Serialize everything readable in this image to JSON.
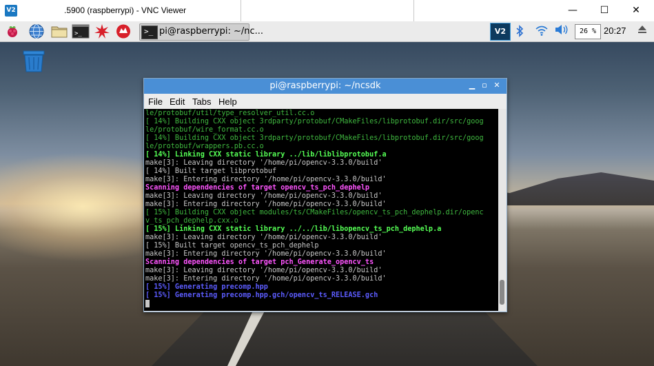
{
  "vnc_window": {
    "logo_text": "V2",
    "title": ".5900 (raspberrypi) - VNC Viewer",
    "controls": {
      "minimize": "—",
      "maximize": "☐",
      "close": "✕"
    }
  },
  "panel": {
    "launchers": [
      "raspberry-menu-icon",
      "web-browser-icon",
      "file-manager-icon",
      "terminal-icon",
      "mathematica-icon",
      "wolfram-icon"
    ],
    "taskbar": {
      "icon_text": ">_",
      "label": "pi@raspberrypi: ~/nc..."
    },
    "tray": {
      "vnc_label": "V2",
      "cpu": "26 %",
      "clock": "20:27"
    }
  },
  "desktop": {
    "trash": "trash-icon"
  },
  "terminal": {
    "title": "pi@raspberrypi: ~/ncsdk",
    "menu": [
      "File",
      "Edit",
      "Tabs",
      "Help"
    ],
    "lines": [
      {
        "text": "le/protobuf/util/type_resolver_util.cc.o",
        "style": "l-green"
      },
      {
        "text": "[ 14%] Building CXX object 3rdparty/protobuf/CMakeFiles/libprotobuf.dir/src/goog",
        "style": "l-green"
      },
      {
        "text": "le/protobuf/wire_format.cc.o",
        "style": "l-green"
      },
      {
        "text": "[ 14%] Building CXX object 3rdparty/protobuf/CMakeFiles/libprotobuf.dir/src/goog",
        "style": "l-green"
      },
      {
        "text": "le/protobuf/wrappers.pb.cc.o",
        "style": "l-green"
      },
      {
        "text": "[ 14%] Linking CXX static library ../lib/liblibprotobuf.a",
        "style": "l-bgreen"
      },
      {
        "text": "make[3]: Leaving directory '/home/pi/opencv-3.3.0/build'",
        "style": "l-grey"
      },
      {
        "text": "[ 14%] Built target libprotobuf",
        "style": "l-grey"
      },
      {
        "text": "make[3]: Entering directory '/home/pi/opencv-3.3.0/build'",
        "style": "l-grey"
      },
      {
        "text": "Scanning dependencies of target opencv_ts_pch_dephelp",
        "style": "l-magenta"
      },
      {
        "text": "make[3]: Leaving directory '/home/pi/opencv-3.3.0/build'",
        "style": "l-grey"
      },
      {
        "text": "make[3]: Entering directory '/home/pi/opencv-3.3.0/build'",
        "style": "l-grey"
      },
      {
        "text": "[ 15%] Building CXX object modules/ts/CMakeFiles/opencv_ts_pch_dephelp.dir/openc",
        "style": "l-green"
      },
      {
        "text": "v_ts_pch_dephelp.cxx.o",
        "style": "l-green"
      },
      {
        "text": "[ 15%] Linking CXX static library ../../lib/libopencv_ts_pch_dephelp.a",
        "style": "l-bgreen"
      },
      {
        "text": "make[3]: Leaving directory '/home/pi/opencv-3.3.0/build'",
        "style": "l-grey"
      },
      {
        "text": "[ 15%] Built target opencv_ts_pch_dephelp",
        "style": "l-grey"
      },
      {
        "text": "make[3]: Entering directory '/home/pi/opencv-3.3.0/build'",
        "style": "l-grey"
      },
      {
        "text": "Scanning dependencies of target pch_Generate_opencv_ts",
        "style": "l-magenta"
      },
      {
        "text": "make[3]: Leaving directory '/home/pi/opencv-3.3.0/build'",
        "style": "l-grey"
      },
      {
        "text": "make[3]: Entering directory '/home/pi/opencv-3.3.0/build'",
        "style": "l-grey"
      },
      {
        "text": "[ 15%] Generating precomp.hpp",
        "style": "l-blue"
      },
      {
        "text": "[ 15%] Generating precomp.hpp.gch/opencv_ts_RELEASE.gch",
        "style": "l-blue"
      }
    ]
  }
}
